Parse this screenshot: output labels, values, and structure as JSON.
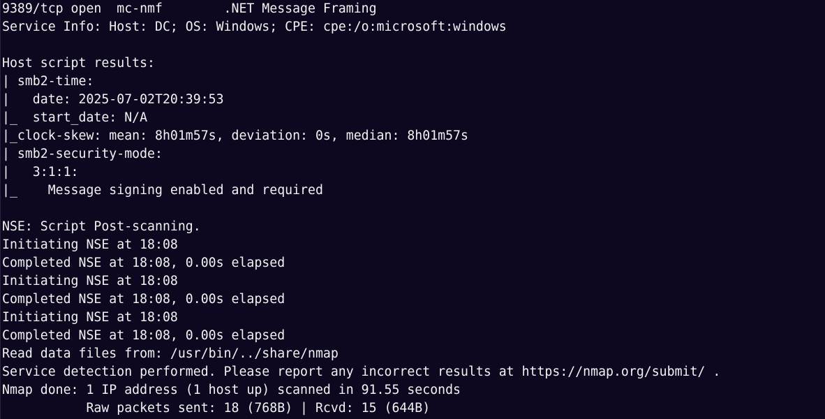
{
  "terminal": {
    "lines": [
      "9389/tcp open  mc-nmf        .NET Message Framing",
      "Service Info: Host: DC; OS: Windows; CPE: cpe:/o:microsoft:windows",
      "",
      "Host script results:",
      "| smb2-time:",
      "|   date: 2025-07-02T20:39:53",
      "|_  start_date: N/A",
      "|_clock-skew: mean: 8h01m57s, deviation: 0s, median: 8h01m57s",
      "| smb2-security-mode:",
      "|   3:1:1:",
      "|_    Message signing enabled and required",
      "",
      "NSE: Script Post-scanning.",
      "Initiating NSE at 18:08",
      "Completed NSE at 18:08, 0.00s elapsed",
      "Initiating NSE at 18:08",
      "Completed NSE at 18:08, 0.00s elapsed",
      "Initiating NSE at 18:08",
      "Completed NSE at 18:08, 0.00s elapsed",
      "Read data files from: /usr/bin/../share/nmap",
      "Service detection performed. Please report any incorrect results at https://nmap.org/submit/ .",
      "Nmap done: 1 IP address (1 host up) scanned in 91.55 seconds",
      "           Raw packets sent: 18 (768B) | Rcvd: 15 (644B)"
    ]
  }
}
